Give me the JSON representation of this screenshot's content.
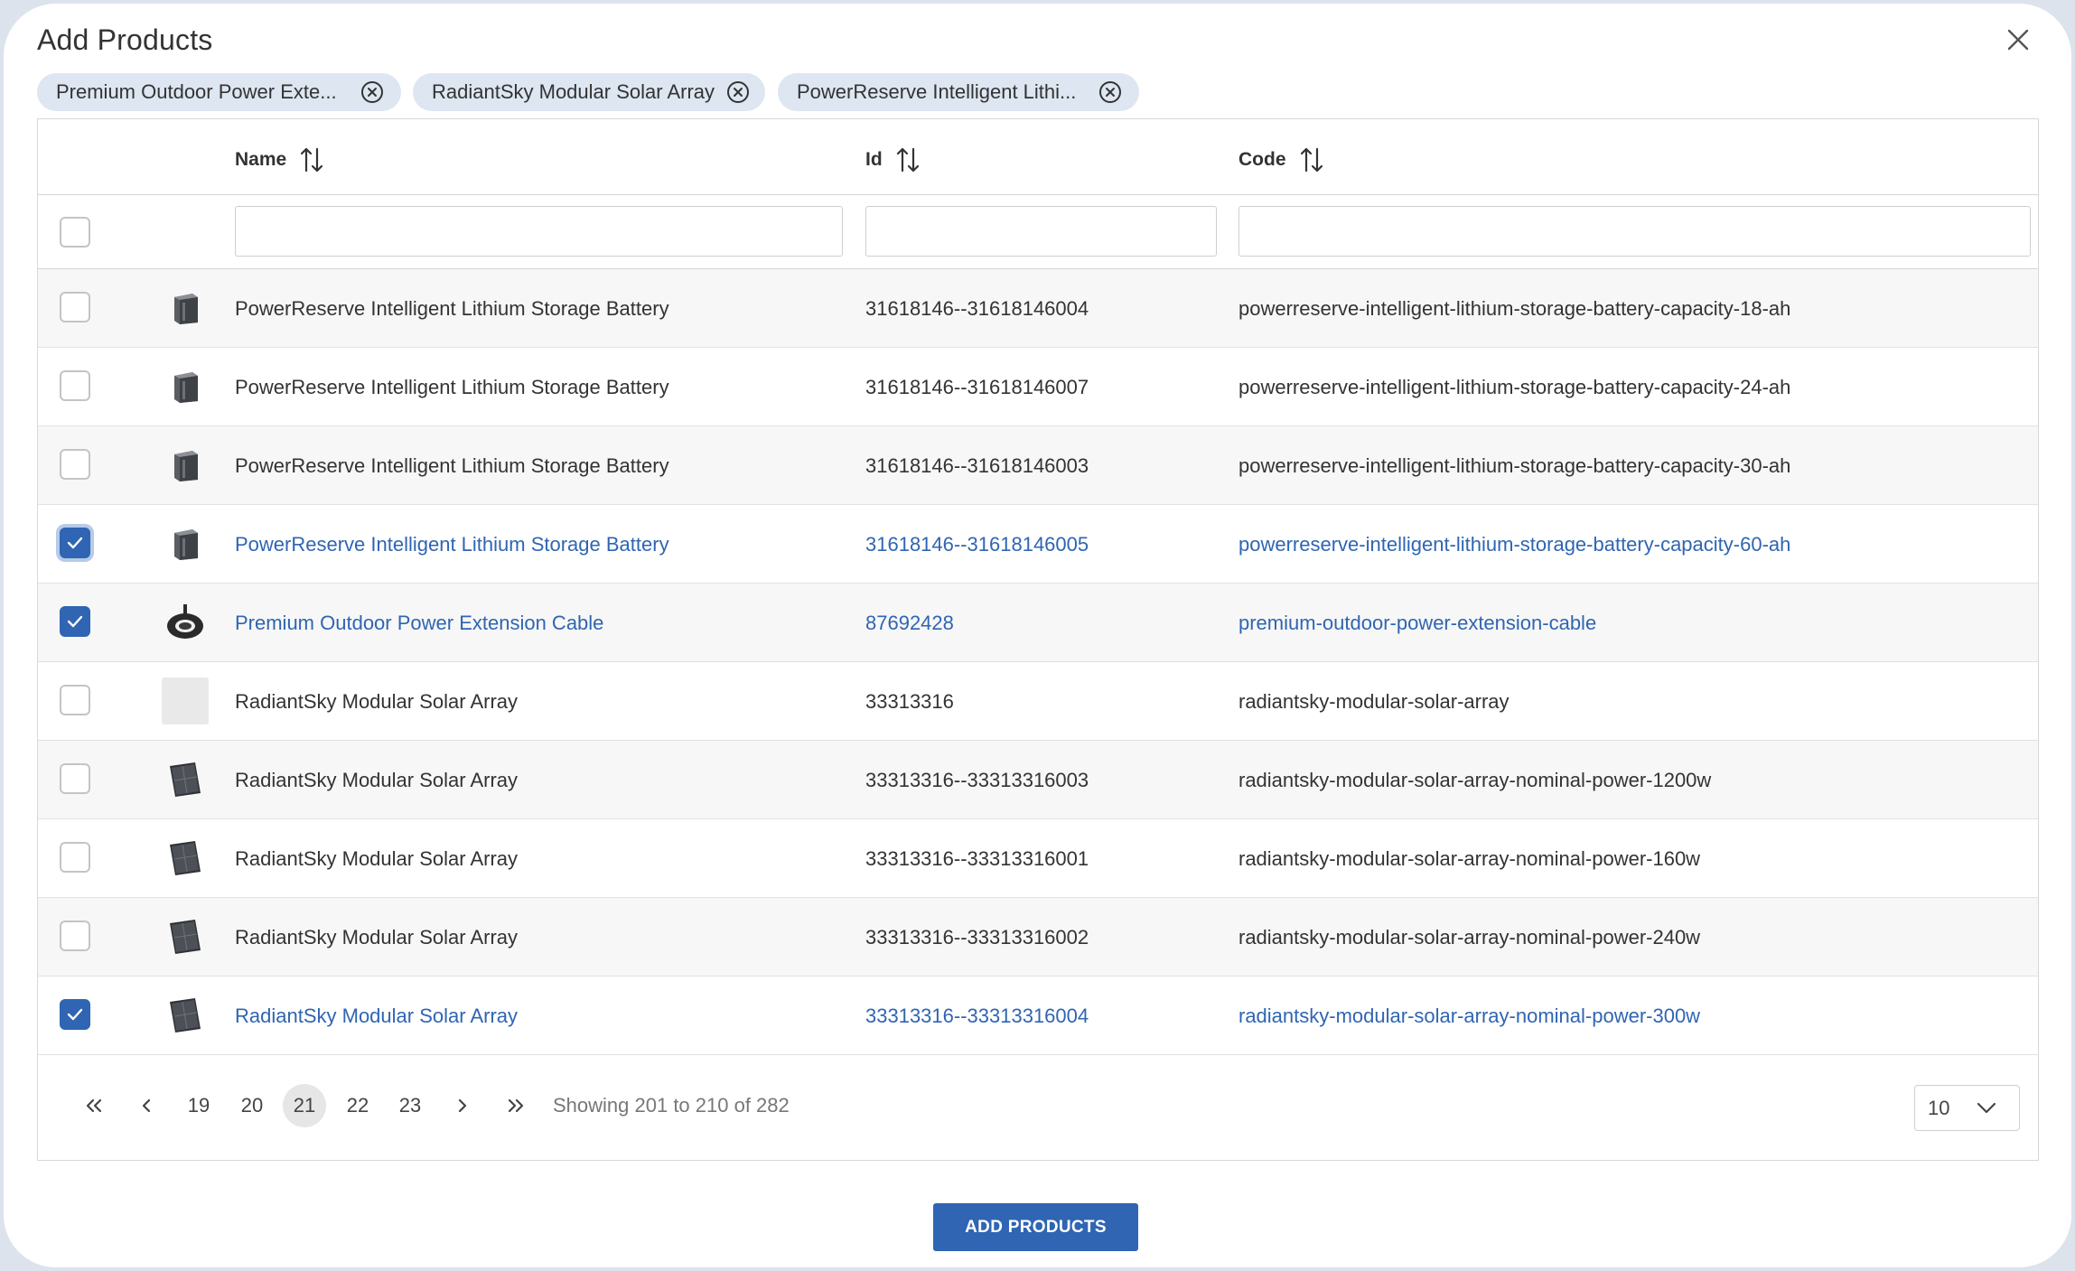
{
  "dialog": {
    "title": "Add Products",
    "close_icon": "close-icon"
  },
  "chips": [
    {
      "label": "Premium Outdoor Power Exte..."
    },
    {
      "label": "RadiantSky Modular Solar Array"
    },
    {
      "label": "PowerReserve Intelligent Lithi..."
    }
  ],
  "table": {
    "columns": {
      "name": "Name",
      "id": "Id",
      "code": "Code"
    },
    "filters": {
      "name": "",
      "id": "",
      "code": ""
    },
    "rows": [
      {
        "name": "PowerReserve Intelligent Lithium Storage Battery",
        "id": "31618146--31618146004",
        "code": "powerreserve-intelligent-lithium-storage-battery-capacity-18-ah",
        "checked": false,
        "thumb": "battery-image"
      },
      {
        "name": "PowerReserve Intelligent Lithium Storage Battery",
        "id": "31618146--31618146007",
        "code": "powerreserve-intelligent-lithium-storage-battery-capacity-24-ah",
        "checked": false,
        "thumb": "battery-image"
      },
      {
        "name": "PowerReserve Intelligent Lithium Storage Battery",
        "id": "31618146--31618146003",
        "code": "powerreserve-intelligent-lithium-storage-battery-capacity-30-ah",
        "checked": false,
        "thumb": "battery-image"
      },
      {
        "name": "PowerReserve Intelligent Lithium Storage Battery",
        "id": "31618146--31618146005",
        "code": "powerreserve-intelligent-lithium-storage-battery-capacity-60-ah",
        "checked": true,
        "thumb": "battery-image"
      },
      {
        "name": "Premium Outdoor Power Extension Cable",
        "id": "87692428",
        "code": "premium-outdoor-power-extension-cable",
        "checked": true,
        "thumb": "cable-reel-image"
      },
      {
        "name": "RadiantSky Modular Solar Array",
        "id": "33313316",
        "code": "radiantsky-modular-solar-array",
        "checked": false,
        "thumb": "placeholder-image"
      },
      {
        "name": "RadiantSky Modular Solar Array",
        "id": "33313316--33313316003",
        "code": "radiantsky-modular-solar-array-nominal-power-1200w",
        "checked": false,
        "thumb": "solar-panel-image"
      },
      {
        "name": "RadiantSky Modular Solar Array",
        "id": "33313316--33313316001",
        "code": "radiantsky-modular-solar-array-nominal-power-160w",
        "checked": false,
        "thumb": "solar-panel-image"
      },
      {
        "name": "RadiantSky Modular Solar Array",
        "id": "33313316--33313316002",
        "code": "radiantsky-modular-solar-array-nominal-power-240w",
        "checked": false,
        "thumb": "solar-panel-image"
      },
      {
        "name": "RadiantSky Modular Solar Array",
        "id": "33313316--33313316004",
        "code": "radiantsky-modular-solar-array-nominal-power-300w",
        "checked": true,
        "thumb": "solar-panel-image"
      }
    ]
  },
  "paginator": {
    "pages": [
      "19",
      "20",
      "21",
      "22",
      "23"
    ],
    "current_page": "21",
    "info": "Showing 201 to 210 of 282",
    "rows_per_page": "10"
  },
  "footer": {
    "add_button_label": "ADD PRODUCTS"
  },
  "colors": {
    "accent": "#2f65b2",
    "chip_bg": "#dde6f1",
    "row_alt": "#f7f7f7"
  }
}
